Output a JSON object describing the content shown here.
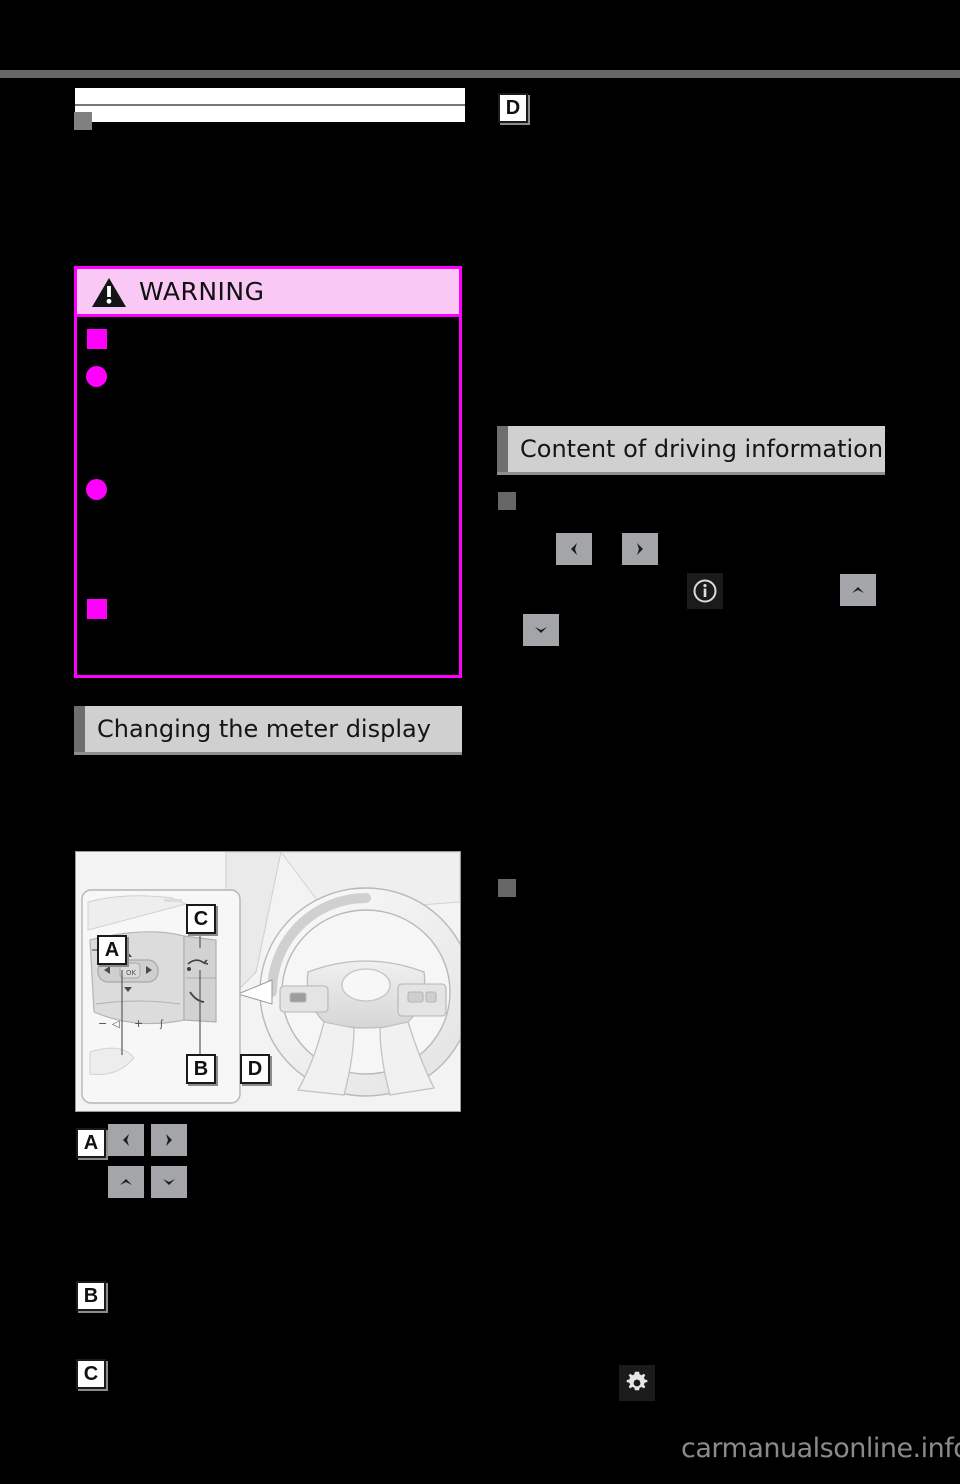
{
  "page": {
    "background": "#000000",
    "watermark": "carmanualsonline.info",
    "accent_warning": "#ff00ff",
    "warning_header_bg": "#f9c8f5",
    "heading_bg": "#d0d0d0",
    "heading_tab": "#6e6e6e",
    "key_button_bg": "#a3a5a8"
  },
  "warning_panel": {
    "title": "WARNING",
    "icon": "warning-triangle-icon",
    "bullets": [
      {
        "marker": "square"
      },
      {
        "marker": "circle"
      },
      {
        "marker": "circle"
      },
      {
        "marker": "square"
      }
    ]
  },
  "headings": {
    "changing_meter_display": "Changing the meter display",
    "content_of_driving_information": "Content of driving information"
  },
  "callouts": {
    "a": "A",
    "b": "B",
    "c": "C",
    "d": "D"
  },
  "illustration": {
    "name": "steering-wheel-switches-illustration",
    "labels": [
      "A",
      "B",
      "C",
      "D"
    ]
  },
  "key_buttons": {
    "left": "chevron-left-icon",
    "right": "chevron-right-icon",
    "up": "chevron-up-icon",
    "down": "chevron-down-icon"
  },
  "glyphs": {
    "info": "info-circle-icon",
    "gear": "gear-icon"
  }
}
